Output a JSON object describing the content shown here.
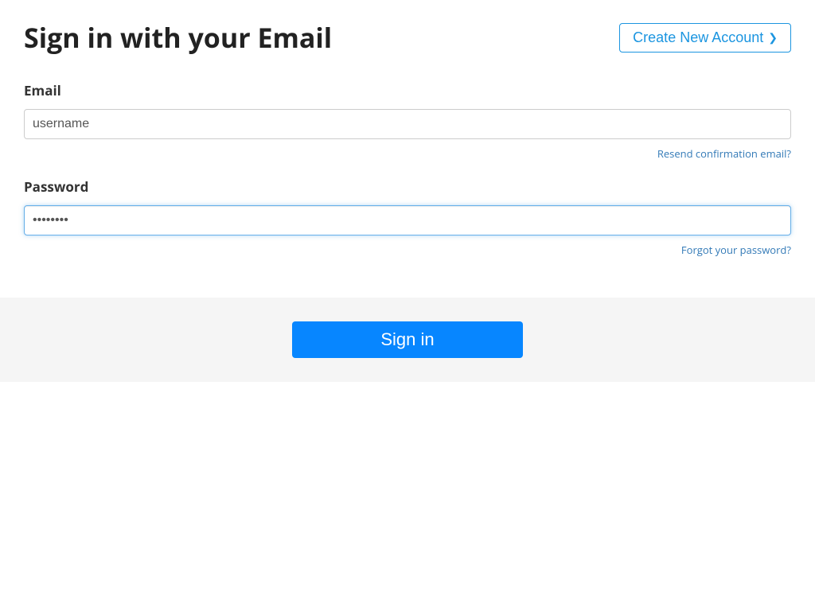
{
  "header": {
    "title": "Sign in with your Email",
    "create_account_label": "Create New Account"
  },
  "form": {
    "email": {
      "label": "Email",
      "value": "username",
      "resend_link": "Resend confirmation email?"
    },
    "password": {
      "label": "Password",
      "value": "password",
      "forgot_link": "Forgot your password?"
    }
  },
  "actions": {
    "signin_label": "Sign in"
  }
}
